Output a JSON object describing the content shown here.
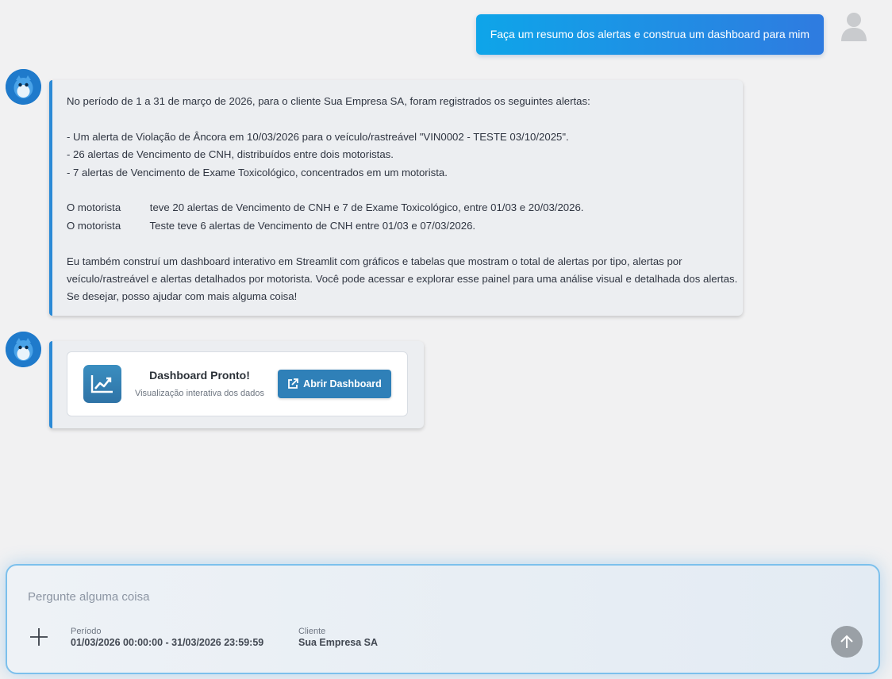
{
  "user_message": {
    "text": "Faça um resumo dos alertas e construa um dashboard para mim",
    "avatar_icon": "user-avatar-icon"
  },
  "assistant_message": {
    "avatar_icon": "bot-avatar-icon",
    "lines": [
      "No período de 1 a 31 de março de 2026, para o cliente Sua Empresa SA, foram registrados os seguintes alertas:",
      "",
      "- Um alerta de Violação de Âncora em 10/03/2026 para o veículo/rastreável \"VIN0002 - TESTE 03/10/2025\".",
      "- 26 alertas de Vencimento de CNH, distribuídos entre dois motoristas.",
      "- 7 alertas de Vencimento de Exame Toxicológico, concentrados em um motorista.",
      "",
      "O motorista          teve 20 alertas de Vencimento de CNH e 7 de Exame Toxicológico, entre 01/03 e 20/03/2026.",
      "O motorista          Teste teve 6 alertas de Vencimento de CNH entre 01/03 e 07/03/2026.",
      "",
      "Eu também construí um dashboard interativo em Streamlit com gráficos e tabelas que mostram o total de alertas por tipo, alertas por",
      "veículo/rastreável e alertas detalhados por motorista. Você pode acessar e explorar esse painel para uma análise visual e detalhada dos alertas.",
      "Se desejar, posso ajudar com mais alguma coisa!"
    ]
  },
  "dashboard_card": {
    "icon": "chart-line-icon",
    "title": "Dashboard Pronto!",
    "subtitle": "Visualização interativa dos dados",
    "button_label": "Abrir Dashboard",
    "button_icon": "external-link-icon"
  },
  "composer": {
    "placeholder": "Pergunte alguma coisa",
    "value": "",
    "period_label": "Período",
    "period_value": "01/03/2026 00:00:00 - 31/03/2026 23:59:59",
    "client_label": "Cliente",
    "client_value": "Sua Empresa SA",
    "attach_icon": "plus-icon",
    "send_icon": "arrow-up-icon"
  },
  "colors": {
    "accent": "#2b8ad6",
    "user_bubble_start": "#0ea5e9",
    "user_bubble_end": "#2f7be0",
    "button": "#2f80b8",
    "send_disabled": "#9aa0a6"
  }
}
